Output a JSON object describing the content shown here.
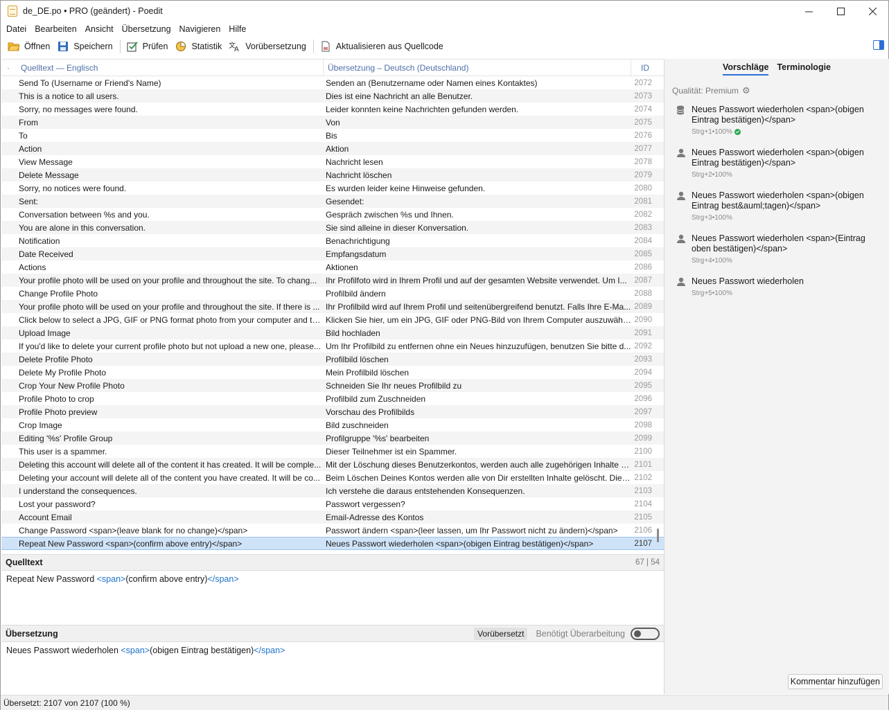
{
  "window": {
    "title": "de_DE.po • PRO (geändert) - Poedit"
  },
  "menu": [
    "Datei",
    "Bearbeiten",
    "Ansicht",
    "Übersetzung",
    "Navigieren",
    "Hilfe"
  ],
  "toolbar": {
    "open": "Öffnen",
    "save": "Speichern",
    "validate": "Prüfen",
    "stats": "Statistik",
    "pretranslate": "Vorübersetzung",
    "update": "Aktualisieren aus Quellcode"
  },
  "list": {
    "dot": "·",
    "col_source": "Quelltext — Englisch",
    "col_translation": "Übersetzung – Deutsch (Deutschland)",
    "col_id": "ID",
    "rows": [
      {
        "src": "Send To (Username or Friend's Name)",
        "tr": "Senden an (Benutzername oder Namen eines Kontaktes)",
        "id": "2072"
      },
      {
        "src": "This is a notice to all users.",
        "tr": "Dies ist eine Nachricht an alle Benutzer.",
        "id": "2073"
      },
      {
        "src": "Sorry, no messages were found.",
        "tr": "Leider konnten keine Nachrichten gefunden werden.",
        "id": "2074"
      },
      {
        "src": "From",
        "tr": "Von",
        "id": "2075"
      },
      {
        "src": "To",
        "tr": "Bis",
        "id": "2076"
      },
      {
        "src": "Action",
        "tr": "Aktion",
        "id": "2077"
      },
      {
        "src": "View Message",
        "tr": "Nachricht lesen",
        "id": "2078"
      },
      {
        "src": "Delete Message",
        "tr": "Nachricht löschen",
        "id": "2079"
      },
      {
        "src": "Sorry, no notices were found.",
        "tr": "Es wurden leider keine Hinweise gefunden.",
        "id": "2080"
      },
      {
        "src": "Sent:",
        "tr": "Gesendet:",
        "id": "2081"
      },
      {
        "src": "Conversation between %s and you.",
        "tr": "Gespräch zwischen %s und Ihnen.",
        "id": "2082"
      },
      {
        "src": "You are alone in this conversation.",
        "tr": "Sie sind alleine in dieser Konversation.",
        "id": "2083"
      },
      {
        "src": "Notification",
        "tr": "Benachrichtigung",
        "id": "2084"
      },
      {
        "src": "Date Received",
        "tr": "Empfangsdatum",
        "id": "2085"
      },
      {
        "src": "Actions",
        "tr": "Aktionen",
        "id": "2086"
      },
      {
        "src": "Your profile photo will be used on your profile and throughout the site. To chang...",
        "tr": "Ihr Profilfoto wird in Ihrem Profil und auf der gesamten Website verwendet. Um I...",
        "id": "2087"
      },
      {
        "src": "Change Profile Photo",
        "tr": "Profilbild ändern",
        "id": "2088"
      },
      {
        "src": "Your profile photo will be used on your profile and throughout the site. If there is ...",
        "tr": "Ihr Profilbild wird auf Ihrem Profil und seitenübergreifend benutzt. Falls Ihre E-Ma...",
        "id": "2089"
      },
      {
        "src": "Click below to select a JPG, GIF or PNG format photo from your computer and th...",
        "tr": "Klicken Sie hier, um ein JPG, GIF oder PNG-Bild von Ihrem Computer auszuwähle...",
        "id": "2090"
      },
      {
        "src": "Upload Image",
        "tr": "Bild hochladen",
        "id": "2091"
      },
      {
        "src": "If you'd like to delete your current profile photo but not upload a new one, please...",
        "tr": "Um Ihr Profilbild zu entfernen ohne ein Neues hinzuzufügen, benutzen Sie bitte d...",
        "id": "2092"
      },
      {
        "src": "Delete Profile Photo",
        "tr": "Profilbild löschen",
        "id": "2093"
      },
      {
        "src": "Delete My Profile Photo",
        "tr": "Mein Profilbild löschen",
        "id": "2094"
      },
      {
        "src": "Crop Your New Profile Photo",
        "tr": "Schneiden Sie Ihr neues Profilbild zu",
        "id": "2095"
      },
      {
        "src": "Profile Photo to crop",
        "tr": "Profilbild zum Zuschneiden",
        "id": "2096"
      },
      {
        "src": "Profile Photo preview",
        "tr": "Vorschau des Profilbilds",
        "id": "2097"
      },
      {
        "src": "Crop Image",
        "tr": "Bild zuschneiden",
        "id": "2098"
      },
      {
        "src": "Editing '%s' Profile Group",
        "tr": "Profilgruppe '%s' bearbeiten",
        "id": "2099"
      },
      {
        "src": "This user is a spammer.",
        "tr": "Dieser Teilnehmer ist ein Spammer.",
        "id": "2100"
      },
      {
        "src": "Deleting this account will delete all of the content it has created. It will be comple...",
        "tr": "Mit der Löschung dieses Benutzerkontos, werden auch alle zugehörigen Inhalte g...",
        "id": "2101"
      },
      {
        "src": "Deleting your account will delete all of the content you have created. It will be co...",
        "tr": "Beim Löschen Deines Kontos werden alle von Dir erstellten Inhalte gelöscht. Diese...",
        "id": "2102"
      },
      {
        "src": "I understand the consequences.",
        "tr": "Ich verstehe die daraus entstehenden Konsequenzen.",
        "id": "2103"
      },
      {
        "src": "Lost your password?",
        "tr": "Passwort vergessen?",
        "id": "2104"
      },
      {
        "src": "Account Email",
        "tr": "Email-Adresse des Kontos",
        "id": "2105"
      },
      {
        "src": "Change Password <span>(leave blank for no change)</span>",
        "tr": "Passwort ändern <span>(leer lassen, um Ihr Passwort nicht zu ändern)</span>",
        "id": "2106"
      },
      {
        "src": "Repeat New Password <span>(confirm above entry)</span>",
        "tr": "Neues Passwort wiederholen <span>(obigen Eintrag bestätigen)</span>",
        "id": "2107",
        "selected": true
      }
    ]
  },
  "source_panel": {
    "title": "Quelltext",
    "count": "67 | 54",
    "text_plain": "Repeat New Password ",
    "tag_open": "<span>",
    "text_inner": "(confirm above entry)",
    "tag_close": "</span>"
  },
  "translation_panel": {
    "title": "Übersetzung",
    "fuzzy_label": "Vorübersetzt",
    "needs_review_label": "Benötigt Überarbeitung",
    "needs_review_on": false,
    "text_plain": "Neues Passwort wiederholen ",
    "tag_open": "<span>",
    "text_inner": "(obigen Eintrag bestätigen)",
    "tag_close": "</span>"
  },
  "status": {
    "text": "Übersetzt: 2107 von 2107 (100 %)"
  },
  "sidebar": {
    "tab_suggestions": "Vorschläge",
    "tab_terminology": "Terminologie",
    "quality": "Qualität: Premium",
    "suggestions": [
      {
        "text": "Neues Passwort wiederholen <span>(obigen Eintrag bestätigen)</span>",
        "shortcut": "Strg+1",
        "score": "100%",
        "icon": "database-icon",
        "exact": true
      },
      {
        "text": "Neues Passwort wiederholen <span>(obigen Eintrag bestätigen)</span>",
        "shortcut": "Strg+2",
        "score": "100%",
        "icon": "person-icon",
        "exact": false
      },
      {
        "text": "Neues Passwort wiederholen <span>(obigen Eintrag best&auml;tagen)</span>",
        "shortcut": "Strg+3",
        "score": "100%",
        "icon": "person-icon",
        "exact": false
      },
      {
        "text": "Neues Passwort wiederholen <span>(Eintrag oben bestätigen)</span>",
        "shortcut": "Strg+4",
        "score": "100%",
        "icon": "person-icon",
        "exact": false
      },
      {
        "text": "Neues Passwort wiederholen",
        "shortcut": "Strg+5",
        "score": "100%",
        "icon": "person-icon",
        "exact": false
      }
    ],
    "add_comment": "Kommentar hinzufügen"
  },
  "colors": {
    "accent": "#2a6fd6",
    "tag": "#1e73c9",
    "selection": "#cfe3f8"
  }
}
